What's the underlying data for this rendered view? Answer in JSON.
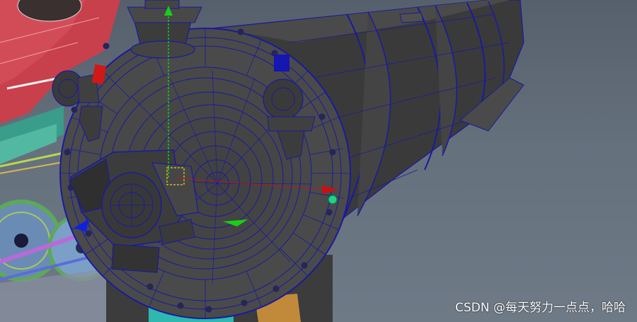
{
  "viewport": {
    "background_top": "#56606c",
    "background_bottom": "#6f7a87",
    "wireframe_color": "#1a1aa0",
    "selection_color": "#e6d21e"
  },
  "manipulator": {
    "x_axis_color": "#cc1010",
    "y_axis_color": "#18d018",
    "z_axis_color": "#1020e0",
    "x_handle_icon": "arrow-icon",
    "y_handle_icon": "arrow-icon",
    "z_handle_icon": "arrow-icon"
  },
  "watermark": {
    "text": "CSDN @每天努力一点点，哈哈"
  }
}
